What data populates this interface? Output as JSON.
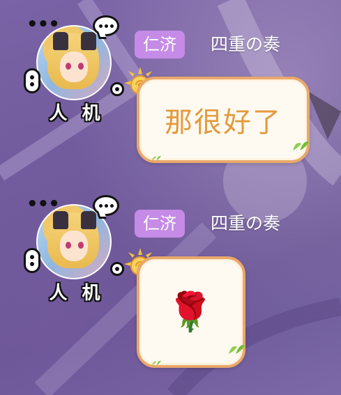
{
  "messages": [
    {
      "avatar_badge": "人 机",
      "tag": "仁济",
      "nickname": "四重の奏",
      "text": "那很好了",
      "emoji": ""
    },
    {
      "avatar_badge": "人 机",
      "tag": "仁济",
      "nickname": "四重の奏",
      "text": "",
      "emoji": "🌹"
    }
  ],
  "colors": {
    "tag_bg": "#c58be6",
    "bubble_border": "#e9a86b",
    "message_text": "#e39a3e",
    "background": "#6f5b9c"
  },
  "icons": [
    "more-dots-icon",
    "chat-bubble-icon",
    "sun-swirl-icon",
    "leaf-icon",
    "rose-emoji"
  ]
}
